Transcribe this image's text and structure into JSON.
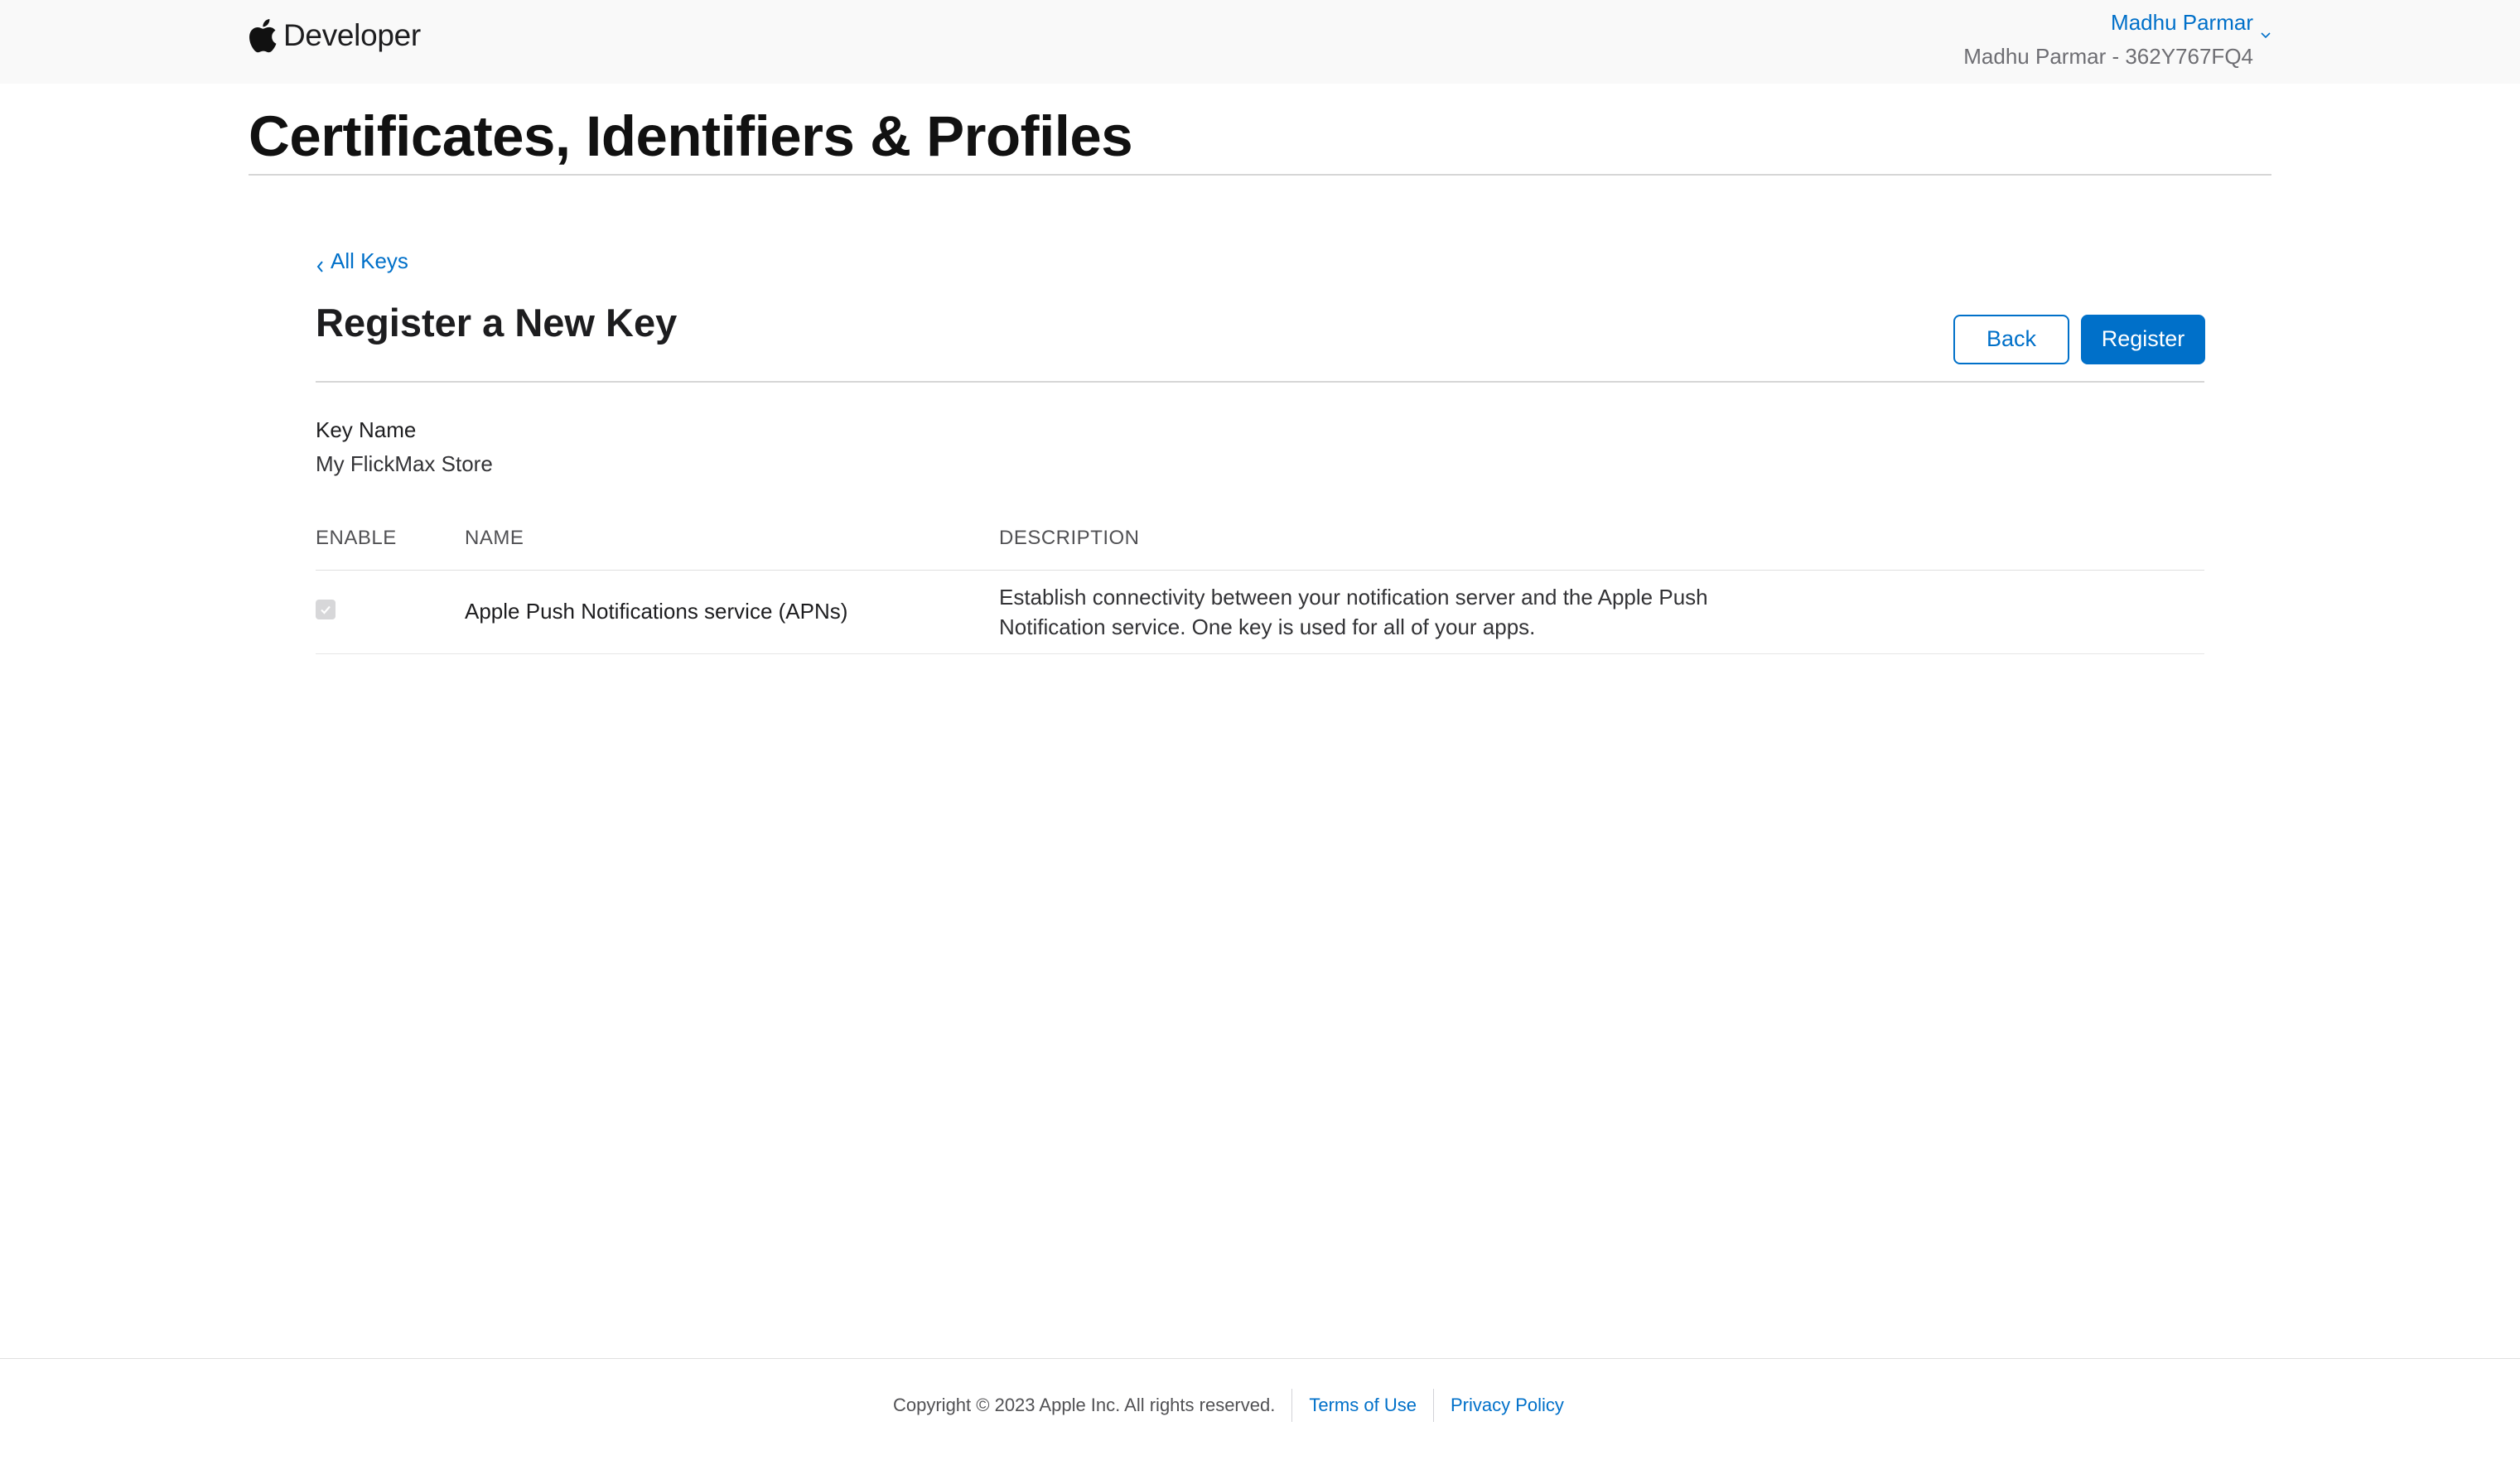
{
  "header": {
    "brand": "Developer",
    "account_name": "Madhu Parmar",
    "team": "Madhu Parmar - 362Y767FQ4"
  },
  "page": {
    "title": "Certificates, Identifiers & Profiles"
  },
  "breadcrumb": {
    "back_label": "All Keys"
  },
  "section": {
    "title": "Register a New Key",
    "back_button": "Back",
    "register_button": "Register"
  },
  "key_name": {
    "label": "Key Name",
    "value": "My FlickMax Store"
  },
  "table": {
    "columns": [
      "ENABLE",
      "NAME",
      "DESCRIPTION"
    ],
    "rows": [
      {
        "enabled": true,
        "name": "Apple Push Notifications service (APNs)",
        "description": "Establish connectivity between your notification server and the Apple Push Notification service. One key is used for all of your apps."
      }
    ]
  },
  "footer": {
    "copyright": "Copyright © 2023 Apple Inc. All rights reserved.",
    "terms": "Terms of Use",
    "privacy": "Privacy Policy"
  },
  "colors": {
    "accent": "#0070c9",
    "header_bg": "#f9f9f9"
  }
}
